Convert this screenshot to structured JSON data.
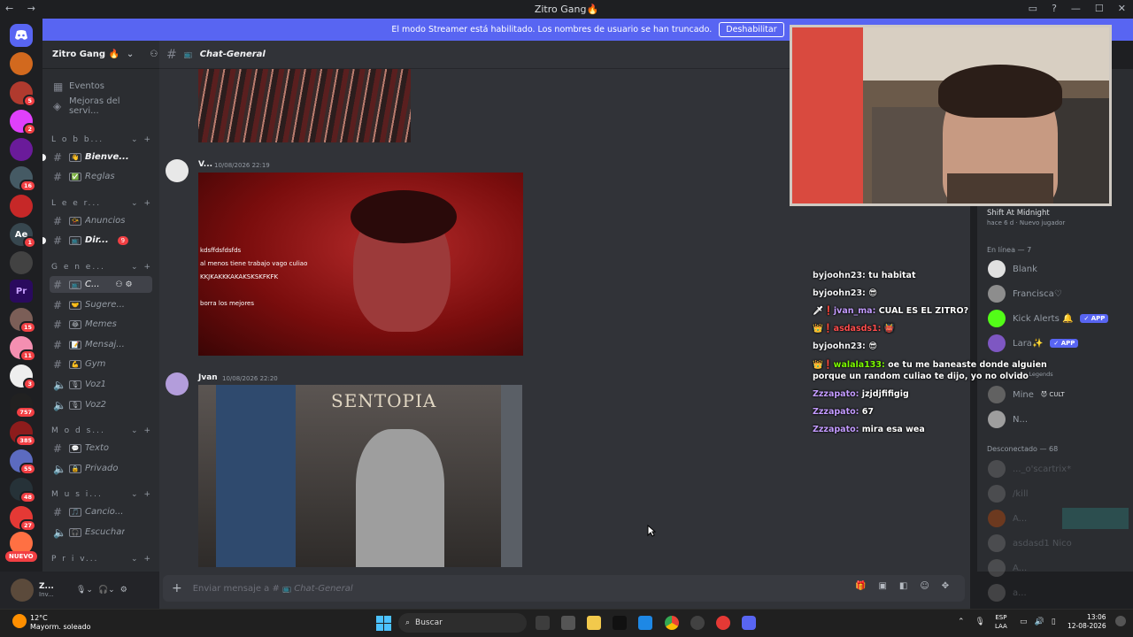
{
  "window": {
    "title": "Zitro Gang🔥"
  },
  "banner": {
    "text": "El modo Streamer está habilitado. Los nombres de usuario se han truncado.",
    "button": "Deshabilitar"
  },
  "rail": {
    "badges": [
      "5",
      "2",
      "16",
      "1",
      "15",
      "11",
      "3",
      "757",
      "385",
      "55",
      "48",
      "27"
    ],
    "nuevo": "NUEVO",
    "ae_label": "Ae",
    "pr_label": "Pr"
  },
  "server": {
    "name": "Zitro Gang 🔥"
  },
  "sidebar": {
    "top_items": [
      "Eventos",
      "Mejoras del servi..."
    ],
    "categories": [
      "L o b b...",
      "L e e r...",
      "G e n e...",
      "M o d s...",
      "M u s i...",
      "P r i v..."
    ],
    "channels": [
      {
        "name": "Bienve...",
        "emoji": "👋"
      },
      {
        "name": "Reglas",
        "emoji": "✅"
      },
      {
        "name": "Anuncios",
        "emoji": "📯"
      },
      {
        "name": "Dir...",
        "emoji": "📺",
        "badge": "9"
      },
      {
        "name": "C...",
        "emoji": "📺"
      },
      {
        "name": "Sugere...",
        "emoji": "🤝"
      },
      {
        "name": "Memes",
        "emoji": "😂"
      },
      {
        "name": "Mensaj...",
        "emoji": "📝"
      },
      {
        "name": "Gym",
        "emoji": "💪"
      },
      {
        "name": "Voz1",
        "emoji": "🎙"
      },
      {
        "name": "Voz2",
        "emoji": "🎙"
      },
      {
        "name": "Texto",
        "emoji": "💬"
      },
      {
        "name": "Privado",
        "emoji": "🔒"
      },
      {
        "name": "Cancio...",
        "emoji": "🎵"
      },
      {
        "name": "Escuchar",
        "emoji": "🎧"
      }
    ]
  },
  "user": {
    "name": "Z...",
    "status": "Inv..."
  },
  "channel_header": {
    "name": "Chat-General",
    "emoji": "📺"
  },
  "messages": [
    {
      "author": "V...",
      "time": "10/08/2026 22:19",
      "captions": [
        "kdsffdsfdsfds",
        "al menos tiene trabajo vago culiao",
        "KKJKAKKKAKAKSKSKFKFK",
        "borra los mejores"
      ]
    },
    {
      "author": "Jvan",
      "time": "10/08/2026 22:20",
      "image_sign": "SENTOPIA"
    }
  ],
  "composer": {
    "placeholder": "Enviar mensaje a #",
    "channel": "Chat-General",
    "emoji": "📺"
  },
  "stream_chat": [
    {
      "user": "byjoohn23:",
      "text": "tu habitat",
      "color": "white"
    },
    {
      "user": "byjoohn23:",
      "text": "😎",
      "color": "white"
    },
    {
      "user": "jvan_ma:",
      "text": "CUAL ES EL ZITRO?",
      "color": "purple",
      "prefix": "🗡❗"
    },
    {
      "user": "asdasds1:",
      "text": "👹",
      "color": "red",
      "prefix": "👑❗"
    },
    {
      "user": "byjoohn23:",
      "text": "😎",
      "color": "white"
    },
    {
      "user": "walala133:",
      "text": "oe tu me baneaste donde alguien porque un random culiao te dijo, yo no olvido",
      "color": "green",
      "prefix": "👑❗"
    },
    {
      "user": "Zzzapato:",
      "text": "jzjdjfifigig",
      "color": "purple"
    },
    {
      "user": "Zzzapato:",
      "text": "67",
      "color": "purple"
    },
    {
      "user": "Zzzapato:",
      "text": "mira esa wea",
      "color": "purple"
    }
  ],
  "members": {
    "playing_title": "Shift At Midnight",
    "playing_sub": "hace 6 d · Nuevo jugador",
    "online_header": "En línea — 7",
    "online": [
      {
        "name": "Blank"
      },
      {
        "name": "Francisca♡"
      },
      {
        "name": "Kick Alerts 🔔",
        "tag": "✓ APP"
      },
      {
        "name": "Lara✨",
        "tag": "✓ APP"
      },
      {
        "name": "Apex Legends",
        "sub": true
      },
      {
        "name": "Mine",
        "tag2": "😈 CULT"
      },
      {
        "name": "N..."
      }
    ],
    "offline_header": "Desconectado — 68",
    "offline": [
      "..._o'scartrix*",
      "/kill",
      "A...",
      "asdasd1 Nico",
      "A...",
      "a..."
    ]
  },
  "taskbar": {
    "weather_temp": "12°C",
    "weather_desc": "Mayorm. soleado",
    "search": "Buscar",
    "lang1": "ESP",
    "lang2": "LAA",
    "time": "13:06",
    "date": "12-08-2026"
  },
  "colors": {
    "blurple": "#5865f2",
    "bg_main": "#313338",
    "bg_sidebar": "#2b2d31",
    "bg_rail": "#1e1f22",
    "red": "#f23f43"
  }
}
